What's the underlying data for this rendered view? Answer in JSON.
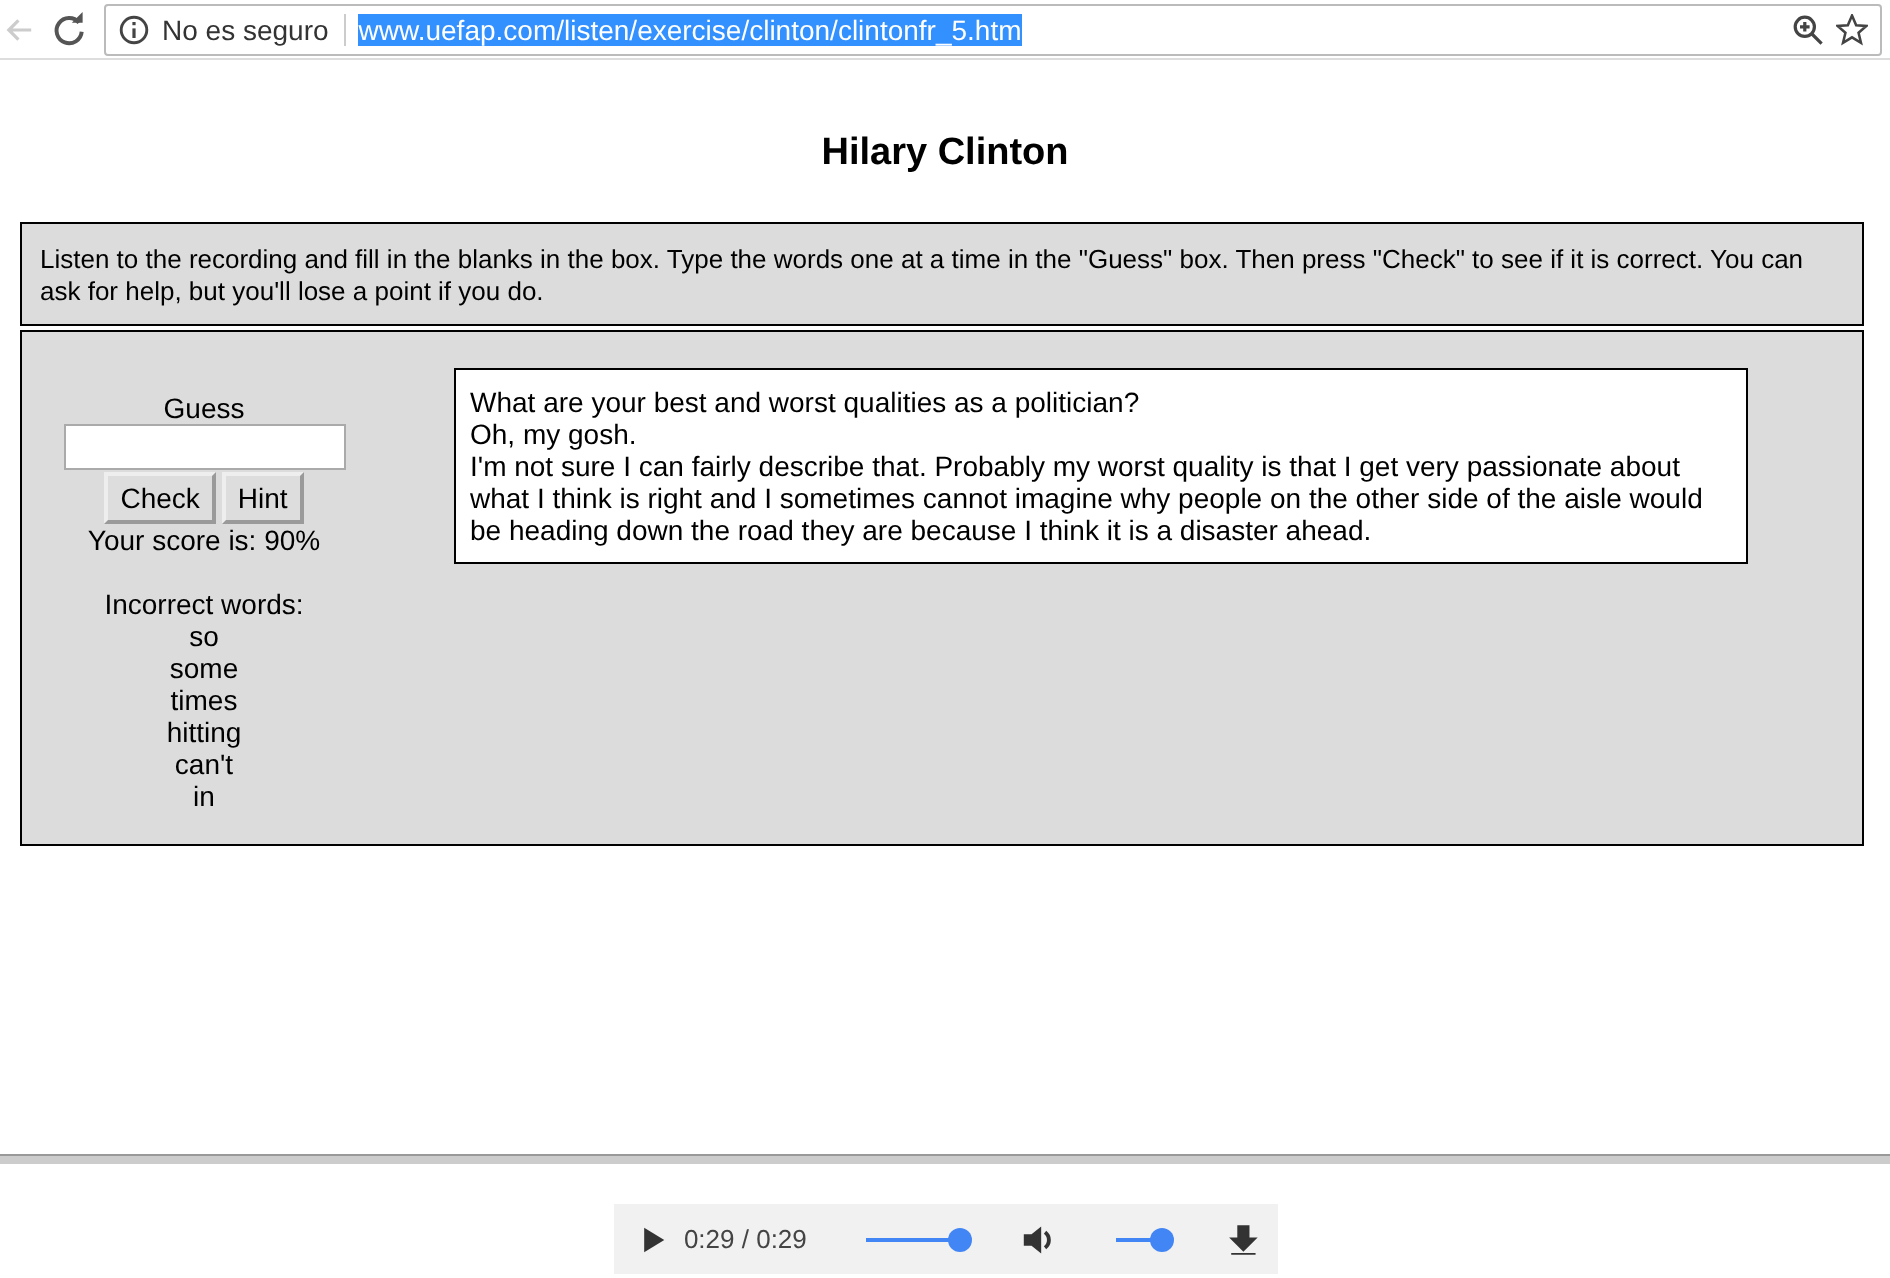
{
  "browser": {
    "back_disabled": true,
    "security": "No es seguro",
    "url": "www.uefap.com/listen/exercise/clinton/clintonfr_5.htm",
    "url_selected": true
  },
  "title": "Hilary Clinton",
  "instructions": "Listen to the recording and fill in the blanks in the box. Type the words one at a time in the \"Guess\" box. Then press \"Check\" to see if it is correct. You can ask for help, but you'll lose a point if you do.",
  "exercise": {
    "guess_label": "Guess",
    "buttons": [
      "Check",
      "Hint"
    ],
    "score": "Your score is: 90%",
    "incorrect_label": "Incorrect words:",
    "incorrect_words": [
      "so",
      "some",
      "times",
      "hitting",
      "can't",
      "in"
    ],
    "transcript": [
      "What are your best and worst qualities as a politician?",
      "Oh, my gosh.",
      "I'm not sure I can fairly describe that. Probably my worst quality is that I get very passionate about what I think is right and I sometimes cannot imagine why people on the other side of the aisle would be heading down the road they are because I think it is a disaster ahead."
    ]
  },
  "player": {
    "time": "0:29 / 0:29",
    "progress": {
      "level": 1
    }
  }
}
